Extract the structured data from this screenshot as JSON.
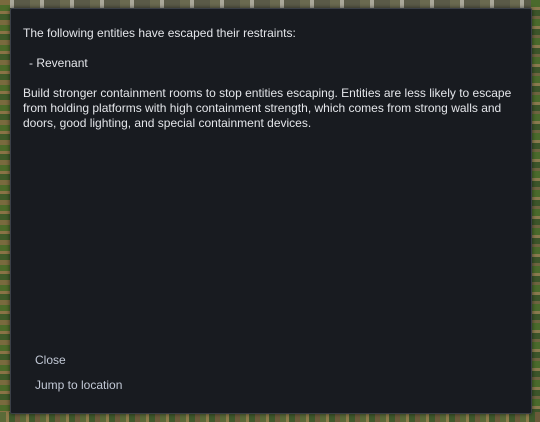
{
  "dialog": {
    "intro_text": "The following entities have escaped their restraints:",
    "entities": [
      {
        "label": "- Revenant"
      }
    ],
    "details_text": "Build stronger containment rooms to stop entities escaping. Entities are less likely to escape from holding platforms with high containment strength, which comes from strong walls and doors, good lighting, and special containment devices.",
    "actions": {
      "close_label": "Close",
      "jump_label": "Jump to location"
    }
  },
  "colors": {
    "dialog_background": "#181b20",
    "text": "#e4e6ea",
    "action_text": "#c2c9d6"
  }
}
